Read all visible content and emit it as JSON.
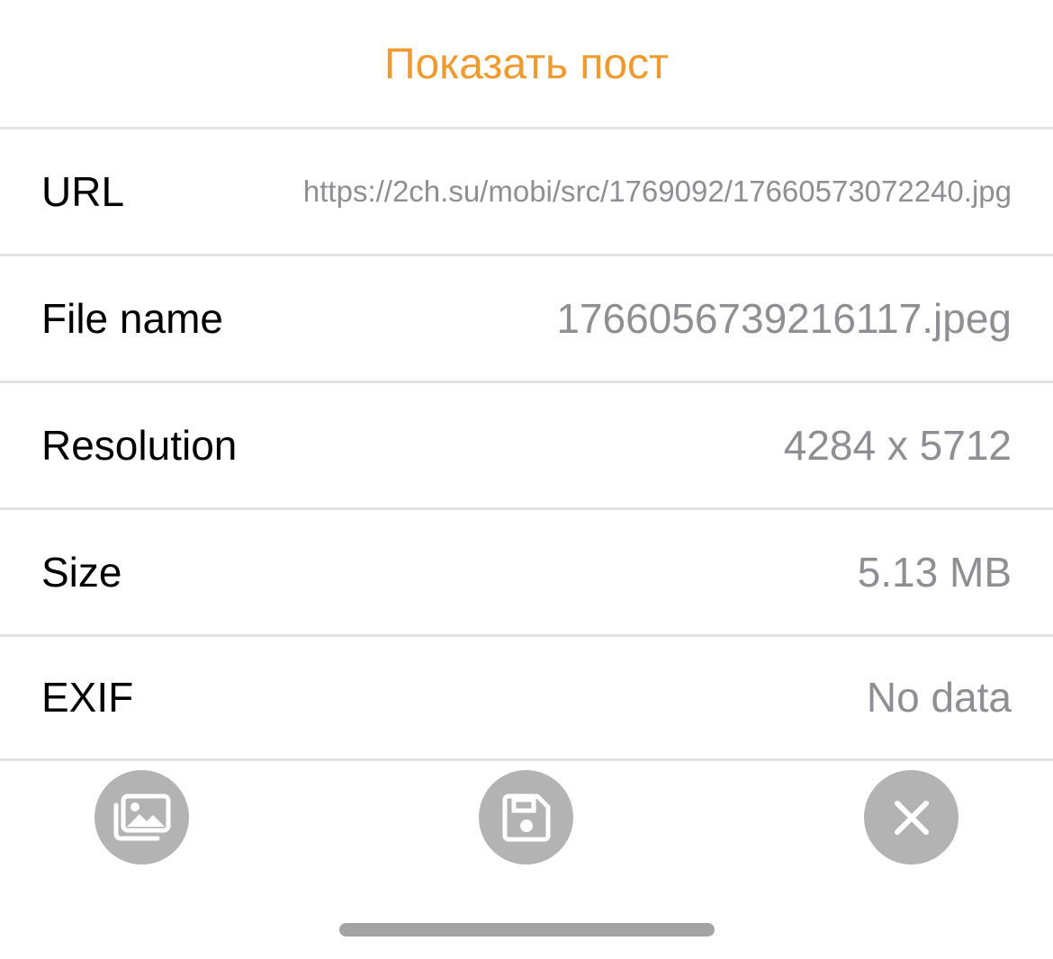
{
  "header": {
    "show_post_label": "Показать пост"
  },
  "details": {
    "rows": [
      {
        "label": "URL",
        "value": "https://2ch.su/mobi/src/1769092/17660573072240.jpg"
      },
      {
        "label": "File name",
        "value": "1766056739216117.jpeg"
      },
      {
        "label": "Resolution",
        "value": "4284 x 5712"
      },
      {
        "label": "Size",
        "value": "5.13 MB"
      },
      {
        "label": "EXIF",
        "value": "No data"
      }
    ]
  },
  "toolbar": {
    "buttons": [
      {
        "icon": "image-gallery-icon"
      },
      {
        "icon": "floppy-disk-icon"
      },
      {
        "icon": "close-icon"
      }
    ]
  },
  "colors": {
    "accent": "#ef9a2e",
    "secondary_text": "#8e8e93",
    "button_bg": "#b3b3b3",
    "divider": "#e2e2e4"
  }
}
